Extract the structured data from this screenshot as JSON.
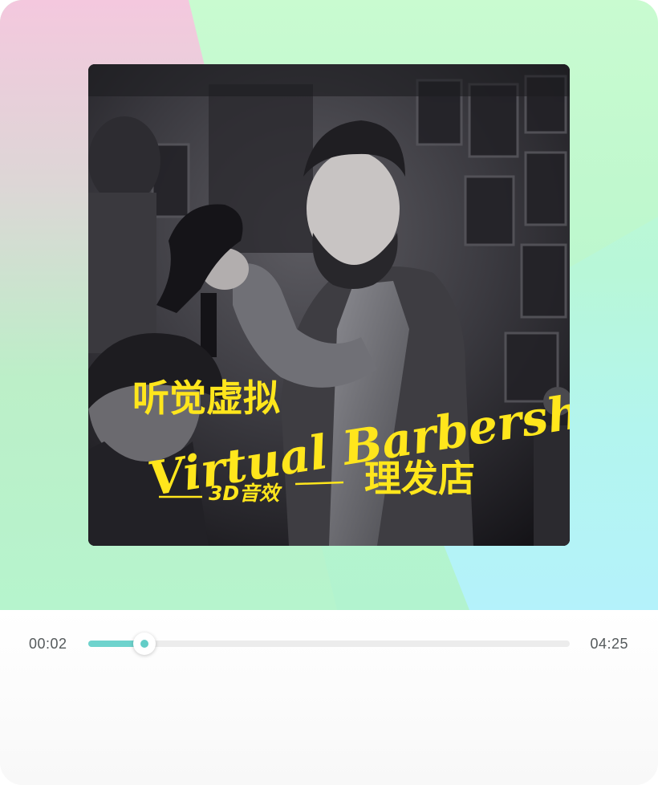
{
  "cover": {
    "title_cn": "听觉虚拟",
    "title_en": "Virtual Barbershop",
    "subtitle_3d": "3D音效",
    "title_cn_2": "理发店"
  },
  "player": {
    "current_time": "00:02",
    "total_time": "04:25",
    "progress_fraction": 0.117
  },
  "colors": {
    "accent": "#6ed3cd",
    "cover_text": "#ffe61c"
  }
}
